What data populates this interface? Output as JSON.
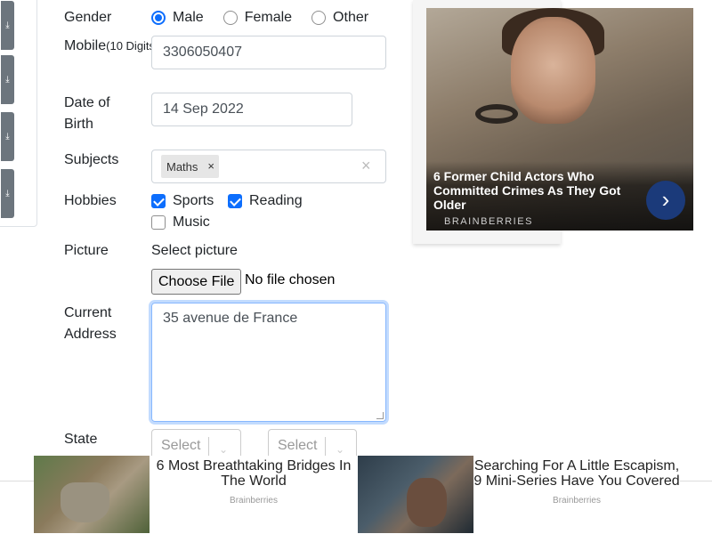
{
  "form": {
    "gender_label": "Gender",
    "gender_options": [
      "Male",
      "Female",
      "Other"
    ],
    "gender_selected": "Male",
    "mobile_label": "Mobile",
    "mobile_hint": "(10 Digits)",
    "mobile_value": "3306050407",
    "dob_label_1": "Date of",
    "dob_label_2": "Birth",
    "dob_value": "14 Sep 2022",
    "subjects_label": "Subjects",
    "subjects_chip": "Maths",
    "chip_remove": "×",
    "subjects_clear": "×",
    "hobbies_label": "Hobbies",
    "hobby_sports": "Sports",
    "hobby_reading": "Reading",
    "hobby_music": "Music",
    "hobbies_checked": [
      "Sports",
      "Reading"
    ],
    "picture_label": "Picture",
    "picture_prompt": "Select picture",
    "file_button": "Choose File",
    "file_status": "No file chosen",
    "address_label_1": "Current",
    "address_label_2": "Address",
    "address_value": "35 avenue de France",
    "state_label": "State",
    "state_placeholder": "Select State",
    "city_placeholder": "Select City"
  },
  "side_icons": [
    "download-icon",
    "download-icon",
    "download-icon",
    "download-icon"
  ],
  "ad_right": {
    "title": "6 Former Child Actors Who Committed Crimes As They Got Older",
    "source": "BRAINBERRIES",
    "arrow": "›"
  },
  "ad_bottom": [
    {
      "title": "6 Most Breathtaking Bridges In The World",
      "source": "Brainberries"
    },
    {
      "title": "Searching For A Little Escapism, 9 Mini-Series Have You Covered",
      "source": "Brainberries"
    }
  ],
  "colors": {
    "accent": "#0d6efd",
    "side_button": "#6c757d",
    "ad_arrow": "#1b3a7a"
  }
}
